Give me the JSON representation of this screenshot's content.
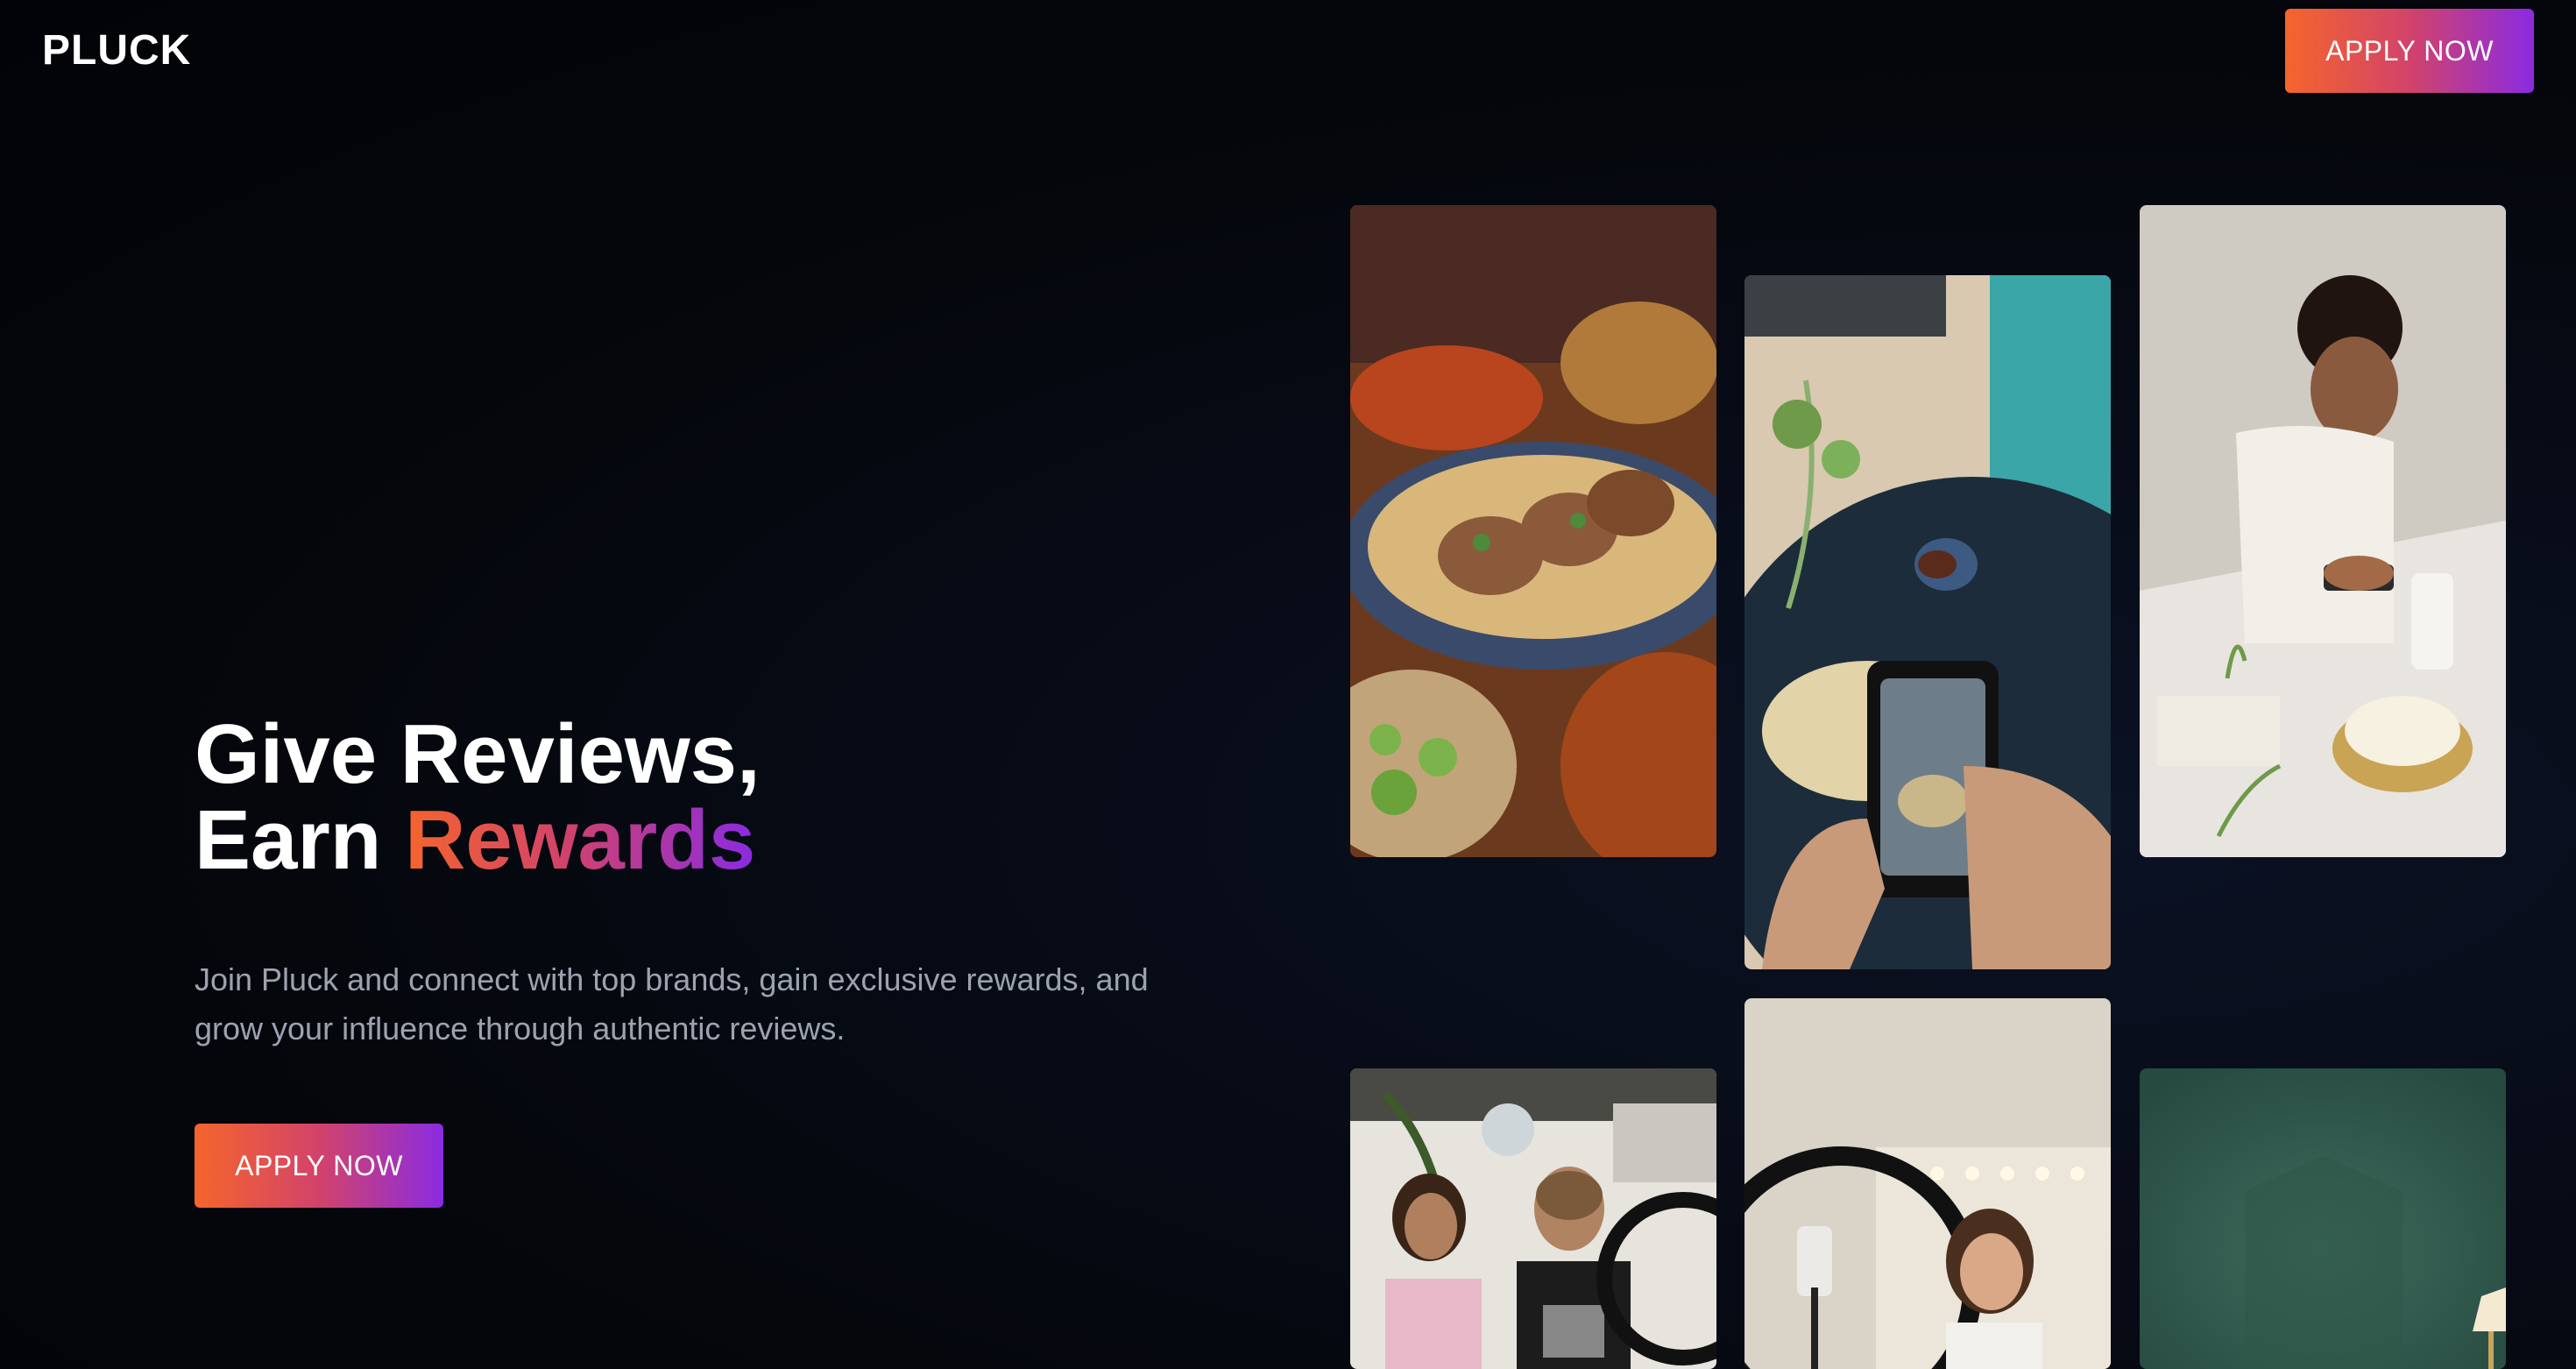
{
  "header": {
    "logo": "PLUCK",
    "cta_label": "APPLY NOW"
  },
  "hero": {
    "title_line1": "Give Reviews,",
    "title_line2_prefix": "Earn ",
    "title_line2_accent": "Rewards",
    "description": "Join Pluck and connect with top brands, gain exclusive rewards, and grow your influence through authentic reviews.",
    "cta_label": "APPLY NOW"
  },
  "gallery": {
    "images": [
      {
        "name": "tacos-photo"
      },
      {
        "name": "phone-coffee-photo"
      },
      {
        "name": "woman-photographing-cake-photo"
      },
      {
        "name": "friends-ring-light-photo"
      },
      {
        "name": "woman-ring-light-photo"
      },
      {
        "name": "green-wall-lamp-photo"
      }
    ]
  },
  "colors": {
    "gradient_start": "#f5652c",
    "gradient_mid": "#d2436a",
    "gradient_end": "#8a2be2",
    "background": "#05070d",
    "muted_text": "#9ca3af"
  }
}
